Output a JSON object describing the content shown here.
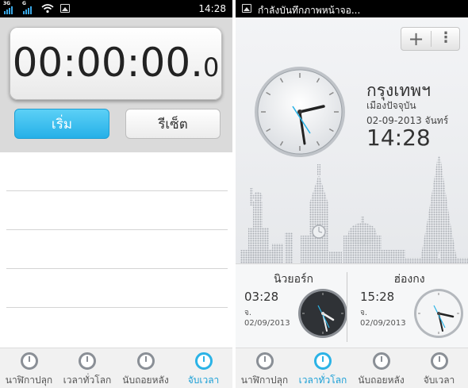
{
  "left": {
    "statusbar": {
      "net1": "3G",
      "net2": "G",
      "time": "14:28"
    },
    "stopwatch": {
      "main": "00:00:00.",
      "fraction": "0"
    },
    "buttons": {
      "start": "เริ่ม",
      "reset": "รีเซ็ต"
    },
    "tabs": [
      {
        "label": "นาฬิกาปลุก"
      },
      {
        "label": "เวลาทั่วโลก"
      },
      {
        "label": "นับถอยหลัง"
      },
      {
        "label": "จับเวลา"
      }
    ]
  },
  "right": {
    "statusbar": {
      "notification": "กำลังบันทึกภาพหน้าจอ..."
    },
    "toolbar": {
      "add": "+",
      "more": "⋮"
    },
    "local": {
      "city": "กรุงเทพฯ",
      "subtitle": "เมืองปัจจุบัน",
      "date": "02-09-2013 จันทร์",
      "time": "14:28"
    },
    "world_clocks": [
      {
        "city": "นิวยอร์ก",
        "time": "03:28",
        "day": "จ.",
        "date": "02/09/2013",
        "theme": "dark"
      },
      {
        "city": "ฮ่องกง",
        "time": "15:28",
        "day": "จ.",
        "date": "02/09/2013",
        "theme": "light"
      }
    ],
    "tabs": [
      {
        "label": "นาฬิกาปลุก"
      },
      {
        "label": "เวลาทั่วโลก"
      },
      {
        "label": "นับถอยหลัง"
      },
      {
        "label": "จับเวลา"
      }
    ]
  },
  "colors": {
    "accent": "#2bb3e6",
    "status_bg": "#000000",
    "second_hand": "#2bb3e6"
  },
  "icons": [
    "signal-icon",
    "wifi-icon",
    "image-icon",
    "alarm-icon",
    "globe-icon",
    "timer-icon",
    "stopwatch-icon",
    "add-icon",
    "more-icon"
  ]
}
